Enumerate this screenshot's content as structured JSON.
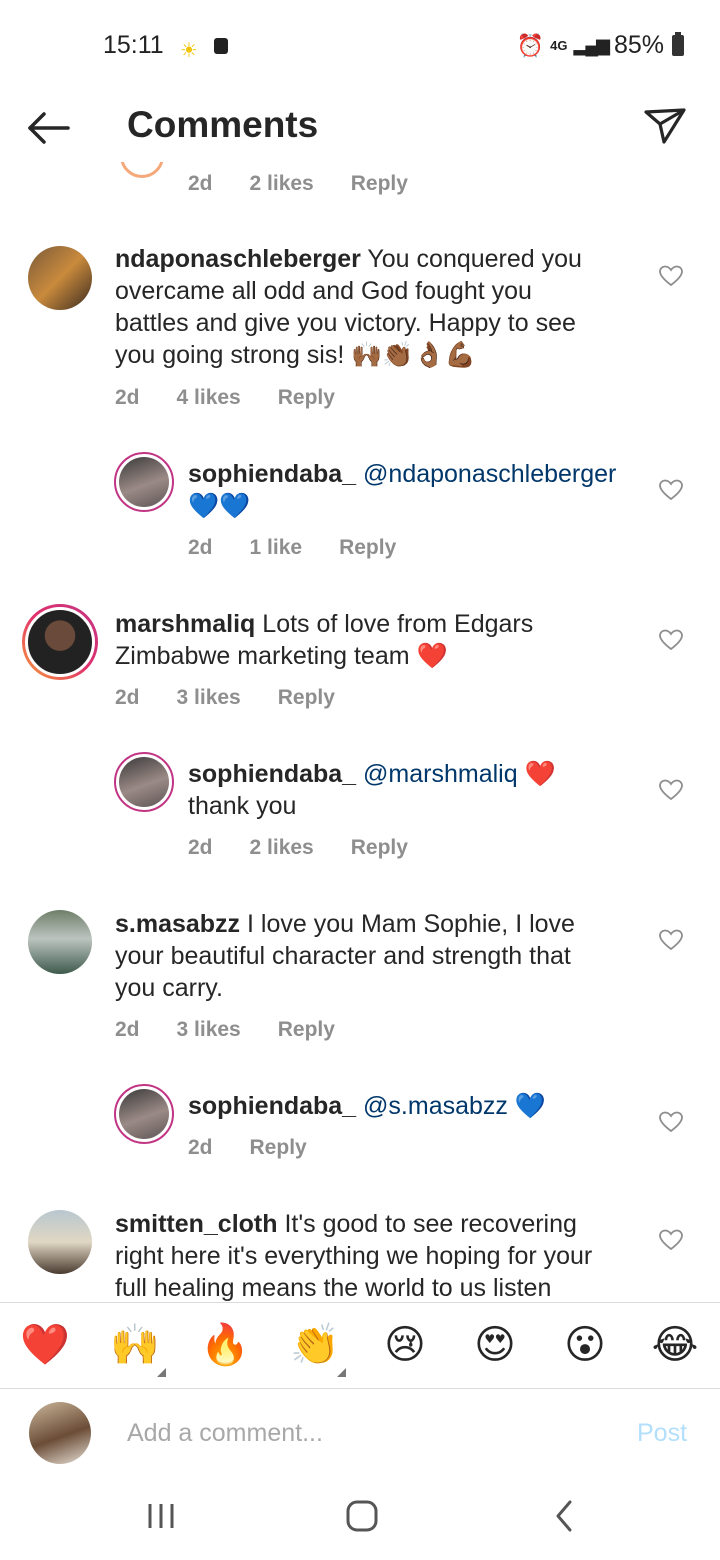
{
  "status": {
    "time": "15:11",
    "network": "4G",
    "battery": "85%"
  },
  "header": {
    "title": "Comments",
    "back_icon": "arrow-left-icon",
    "send_icon": "paper-plane-icon"
  },
  "partial_comment": {
    "time": "2d",
    "likes": "2 likes",
    "reply": "Reply"
  },
  "comments": [
    {
      "username": "ndaponaschleberger",
      "text": " You conquered you",
      "line2": "overcame all odd and God fought you",
      "line3": "battles and give you victory. Happy to see",
      "line4": "you going strong sis! 🙌🏾👏🏾👌🏾💪🏾",
      "time": "2d",
      "likes": "4 likes",
      "reply": "Reply"
    },
    {
      "username": "sophiendaba_",
      "mention": " @ndaponaschleberger",
      "line2": "💙💙",
      "time": "2d",
      "likes": "1 like",
      "reply": "Reply"
    },
    {
      "username": "marshmaliq",
      "text": " Lots of love from Edgars",
      "line2": "Zimbabwe marketing team ❤️",
      "time": "2d",
      "likes": "3 likes",
      "reply": "Reply"
    },
    {
      "username": "sophiendaba_",
      "mention": " @marshmaliq",
      "text": " ❤️",
      "line2": "thank you",
      "time": "2d",
      "likes": "2 likes",
      "reply": "Reply"
    },
    {
      "username": "s.masabzz",
      "text": " I love you Mam Sophie, I love",
      "line2": "your beautiful character and strength that",
      "line3": "you carry.",
      "time": "2d",
      "likes": "3 likes",
      "reply": "Reply"
    },
    {
      "username": "sophiendaba_",
      "mention": " @s.masabzz",
      "text": " 💙",
      "time": "2d",
      "reply": "Reply"
    },
    {
      "username": "smitten_cloth",
      "text": " It's good to see recovering",
      "line2": "right here it's everything we hoping for your",
      "line3": "full healing means the world to us listen"
    }
  ],
  "emoji_bar": [
    "❤️",
    "🙌",
    "🔥",
    "👏",
    "😢",
    "😍",
    "😮",
    "😂"
  ],
  "composer": {
    "placeholder": "Add a comment...",
    "post": "Post"
  },
  "colors": {
    "mention": "#00376b",
    "meta": "#8e8e8e",
    "post_disabled": "#b2dffc",
    "story_ring": "#c13584"
  }
}
